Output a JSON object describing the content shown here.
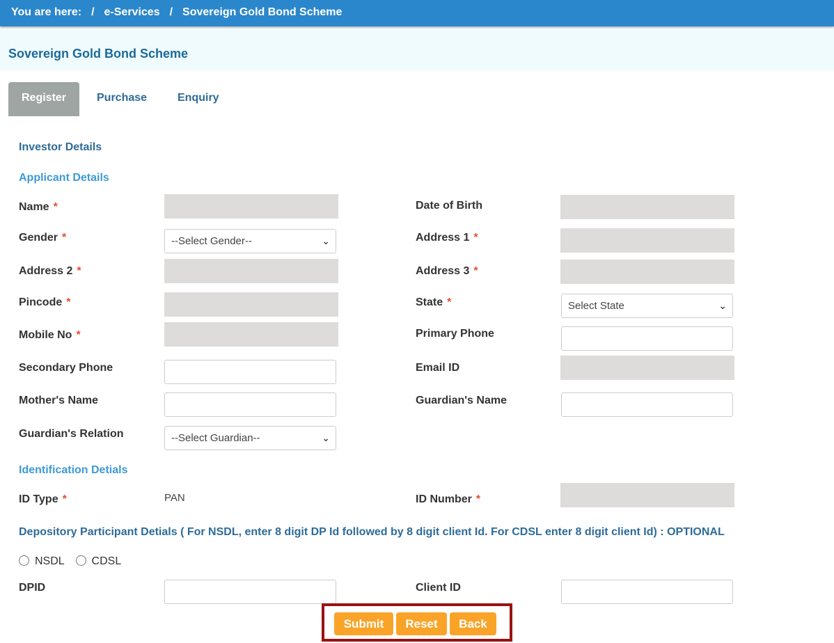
{
  "breadcrumb": [
    "You are here:",
    "/",
    "e-Services",
    "/",
    "Sovereign Gold Bond Scheme"
  ],
  "page_title": "Sovereign Gold Bond Scheme",
  "tabs": [
    "Register",
    "Purchase",
    "Enquiry"
  ],
  "sections": {
    "investor": "Investor Details",
    "applicant": "Applicant Details",
    "identification": "Identification Detials",
    "depository": "Depository Participant Detials ( For NSDL, enter 8 digit DP Id followed by 8 digit client Id. For CDSL enter 8 digit client Id) : OPTIONAL"
  },
  "labels": {
    "name": "Name",
    "dob": "Date of Birth",
    "gender": "Gender",
    "address1": "Address 1",
    "address2": "Address 2",
    "address3": "Address 3",
    "pincode": "Pincode",
    "state": "State",
    "mobile": "Mobile No",
    "primary_phone": "Primary Phone",
    "secondary_phone": "Secondary Phone",
    "email": "Email ID",
    "mother": "Mother's Name",
    "guardian": "Guardian's Name",
    "guardian_relation": "Guardian's Relation",
    "id_type": "ID Type",
    "id_number": "ID Number",
    "dpid": "DPID",
    "client_id": "Client ID",
    "required": "*"
  },
  "values": {
    "gender": "--Select Gender--",
    "state": "Select State",
    "guardian_relation": "--Select Guardian--",
    "id_type": "PAN"
  },
  "radios": [
    "NSDL",
    "CDSL"
  ],
  "buttons": {
    "submit": "Submit",
    "reset": "Reset",
    "back": "Back"
  },
  "colors": {
    "header": "#2b87cb",
    "button": "#f9a428",
    "highlight": "#9a1212"
  }
}
